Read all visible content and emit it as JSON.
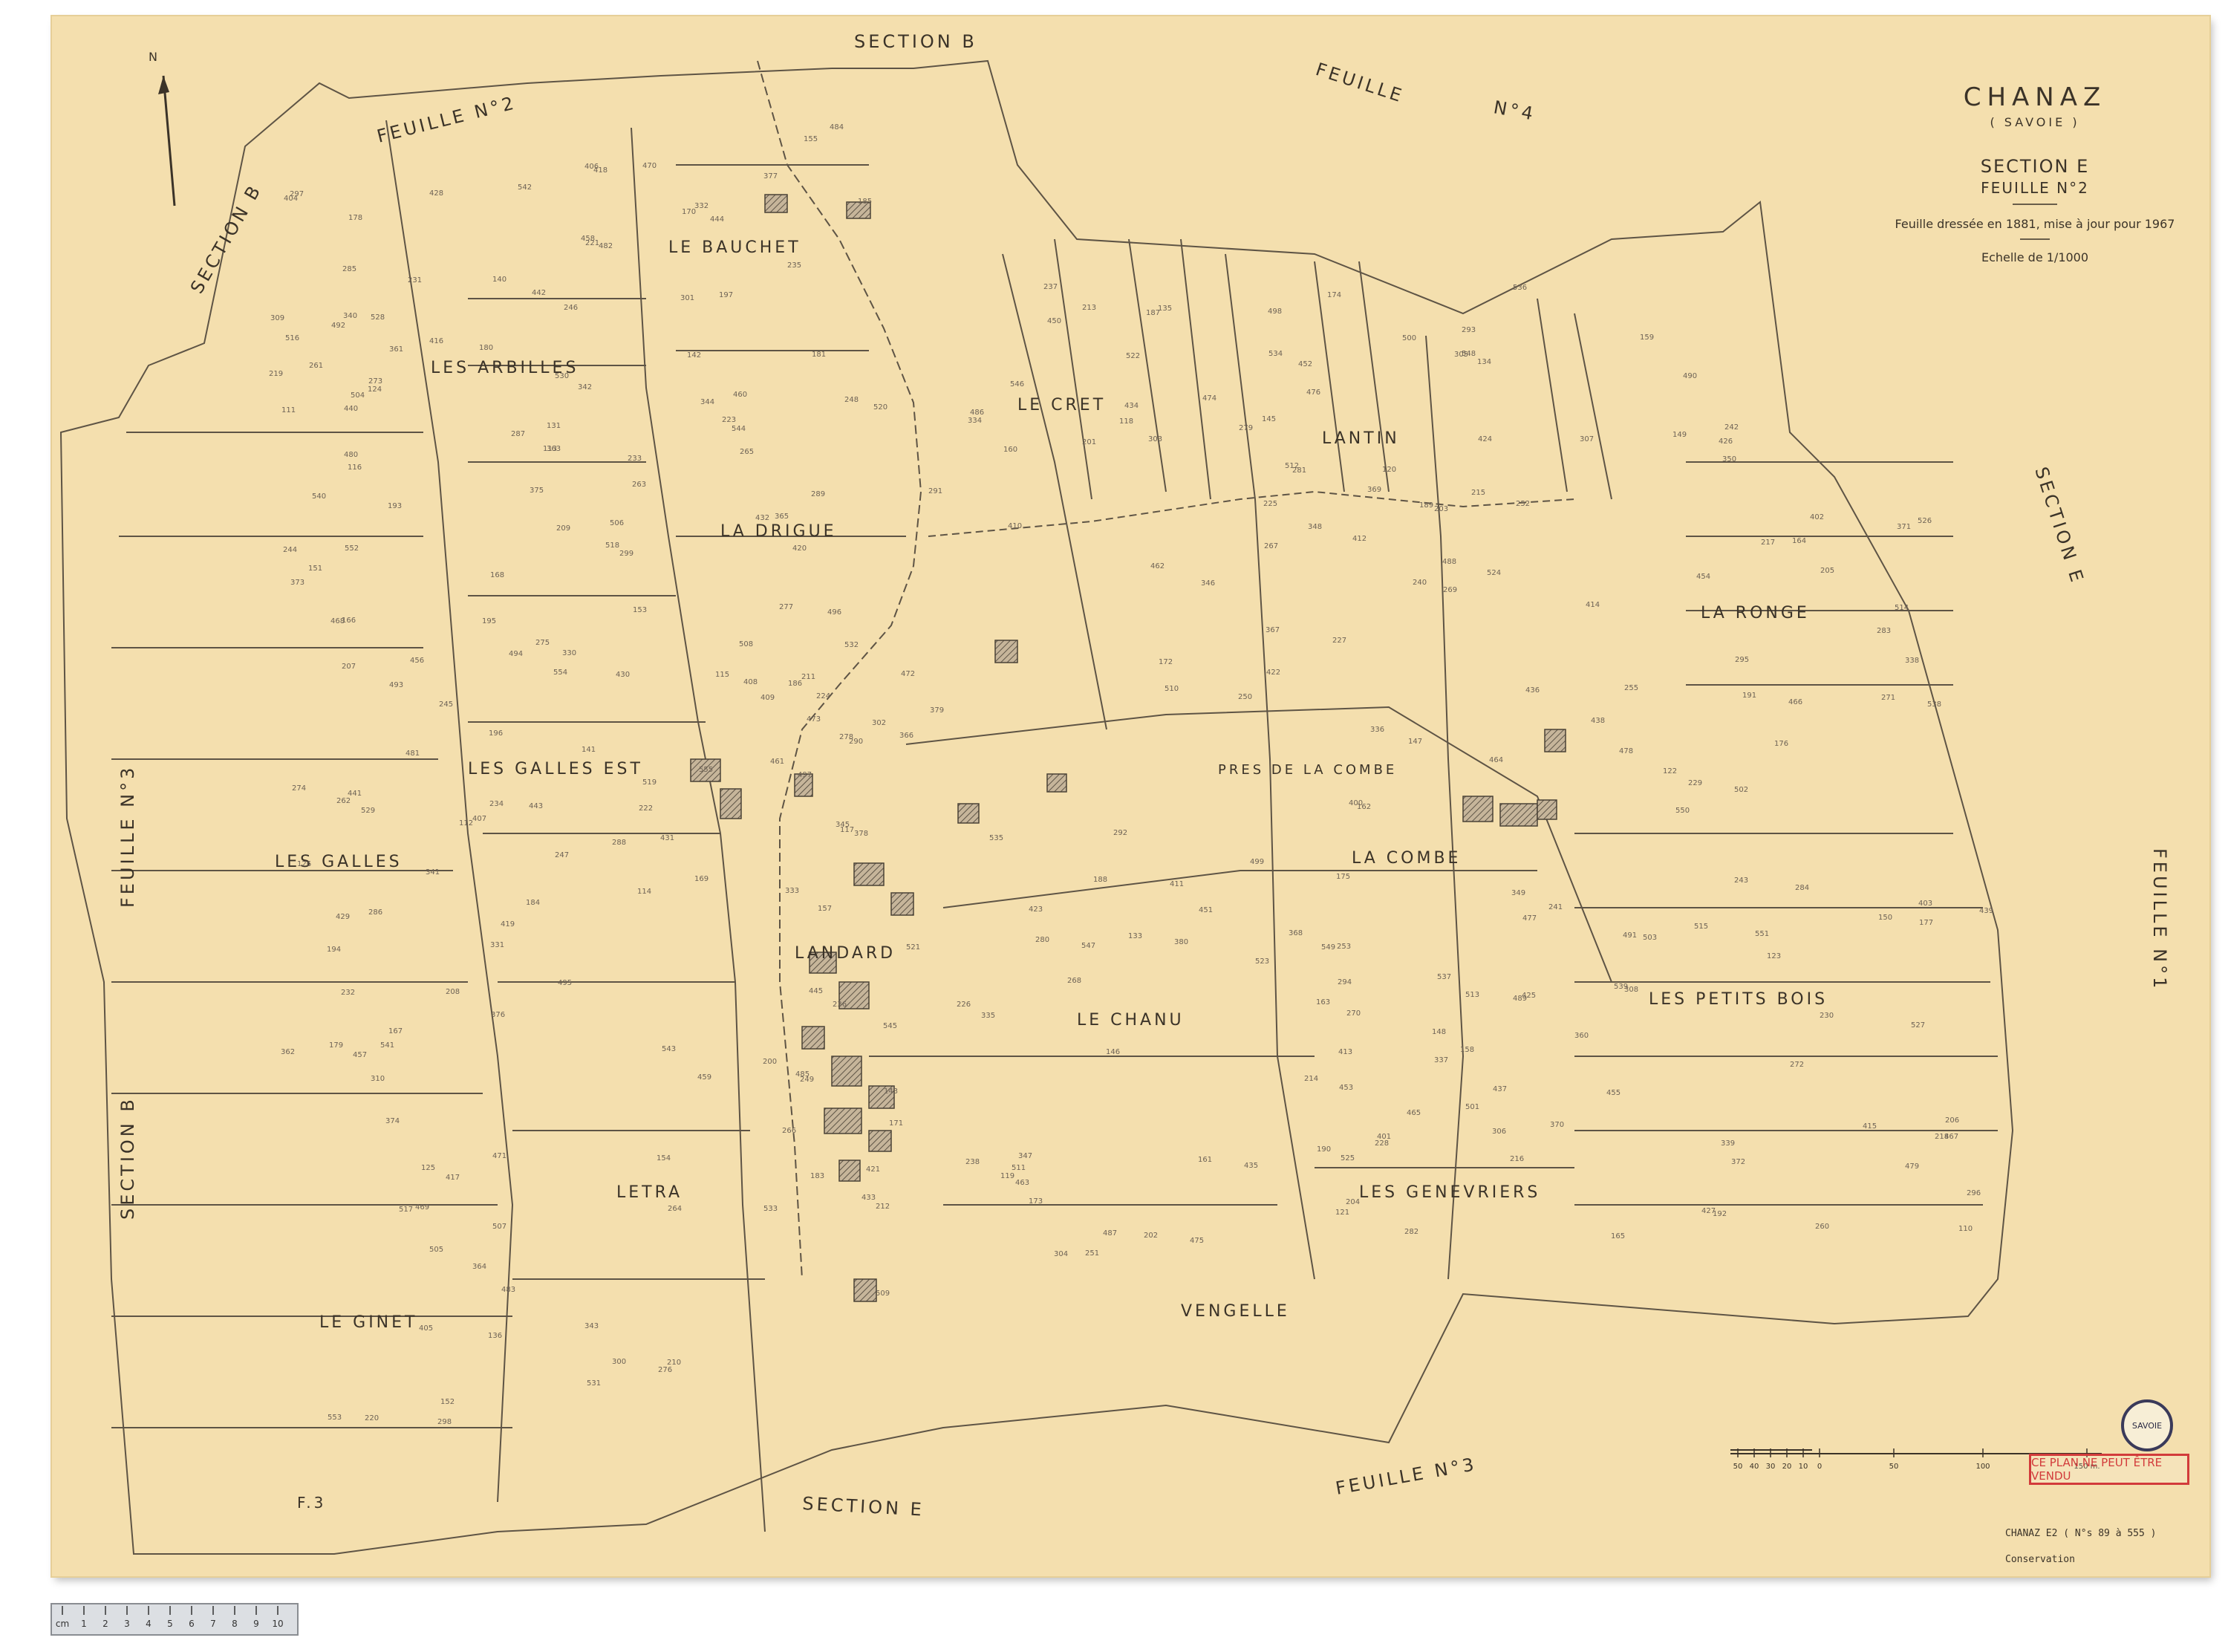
{
  "title": {
    "commune": "CHANAZ",
    "department": "( SAVOIE )",
    "section": "SECTION E",
    "sheet": "FEUILLE N°2",
    "note": "Feuille dressée en 1881, mise à jour pour 1967",
    "scale": "Echelle de 1/1000"
  },
  "north_label": "N",
  "border_labels": {
    "top_section": "SECTION   B",
    "top_left_feuille": "FEUILLE  N°2",
    "top_right_feuille": "FEUILLE",
    "top_right_no": "N°4",
    "left_section_top": "SECTION   B",
    "left_feuille": "FEUILLE  N°3",
    "left_section_bottom": "SECTION   B",
    "right_section": "SECTION   E",
    "right_feuille": "FEUILLE   N°1",
    "bottom_section": "SECTION   E",
    "bottom_feuille": "FEUILLE   N°3",
    "bottom_left_ref": "F.3"
  },
  "localities": [
    "LE BAUCHET",
    "LES ARBILLES",
    "LA DRIGUE",
    "LE CRET",
    "LANTIN",
    "LA RONGE",
    "LES GALLES EST",
    "LES GALLES",
    "LANDARD",
    "PRES DE LA COMBE",
    "LA COMBE",
    "LE CHANU",
    "LES PETITS BOIS",
    "LES GENEVRIERS",
    "LETRA",
    "LE GINET",
    "VENGELLE"
  ],
  "parcel_numbers": [
    "116",
    "126",
    "131",
    "136",
    "181",
    "183",
    "135",
    "133",
    "134",
    "158",
    "159",
    "110",
    "111",
    "112",
    "113",
    "114",
    "115",
    "117",
    "118",
    "119",
    "120",
    "121",
    "122",
    "123",
    "124",
    "125",
    "140",
    "141",
    "142",
    "143",
    "145",
    "146",
    "147",
    "148",
    "149",
    "150",
    "151",
    "152",
    "153",
    "154",
    "155",
    "157",
    "160",
    "161",
    "162",
    "163",
    "164",
    "165",
    "166",
    "167",
    "168",
    "169",
    "170",
    "171",
    "172",
    "173",
    "174",
    "175",
    "176",
    "177",
    "178",
    "179",
    "180",
    "184",
    "185",
    "186",
    "187",
    "188",
    "189",
    "190",
    "191",
    "192",
    "193",
    "194",
    "195",
    "196",
    "197",
    "200",
    "201",
    "202",
    "203",
    "204",
    "205",
    "206",
    "207",
    "208",
    "209",
    "210",
    "211",
    "212",
    "213",
    "214",
    "215",
    "216",
    "217",
    "218",
    "219",
    "220",
    "221",
    "222",
    "223",
    "224",
    "225",
    "226",
    "227",
    "228",
    "229",
    "230",
    "231",
    "232",
    "233",
    "234",
    "235",
    "236",
    "237",
    "238",
    "240",
    "241",
    "242",
    "243",
    "244",
    "245",
    "246",
    "247",
    "248",
    "249",
    "250",
    "251",
    "252",
    "253",
    "255",
    "260",
    "261",
    "262",
    "263",
    "264",
    "265",
    "266",
    "267",
    "268",
    "269",
    "270",
    "271",
    "272",
    "273",
    "274",
    "275",
    "276",
    "277",
    "278",
    "279",
    "280",
    "281",
    "282",
    "283",
    "284",
    "285",
    "286",
    "287",
    "288",
    "289",
    "290",
    "291",
    "292",
    "293",
    "294",
    "295",
    "296",
    "297",
    "298",
    "299",
    "300",
    "301",
    "302",
    "303",
    "304",
    "305",
    "306",
    "307",
    "308",
    "309",
    "310",
    "330",
    "331",
    "332",
    "333",
    "334",
    "335",
    "336",
    "337",
    "338",
    "339",
    "340",
    "341",
    "342",
    "343",
    "344",
    "345",
    "346",
    "347",
    "348",
    "349",
    "350",
    "360",
    "361",
    "362",
    "363",
    "364",
    "365",
    "366",
    "367",
    "368",
    "369",
    "370",
    "371",
    "372",
    "373",
    "374",
    "375",
    "376",
    "377",
    "378",
    "379",
    "380",
    "400",
    "401",
    "402",
    "403",
    "404",
    "405",
    "406",
    "407",
    "408",
    "409",
    "410",
    "411",
    "412",
    "413",
    "414",
    "415",
    "416",
    "417",
    "418",
    "419",
    "420",
    "421",
    "422",
    "423",
    "424",
    "425",
    "426",
    "427",
    "428",
    "429",
    "430",
    "431",
    "432",
    "433",
    "434",
    "435",
    "436",
    "437",
    "438",
    "439",
    "440",
    "441",
    "442",
    "443",
    "444",
    "445",
    "450",
    "451",
    "452",
    "453",
    "454",
    "455",
    "456",
    "457",
    "458",
    "459",
    "460",
    "461",
    "462",
    "463",
    "464",
    "465",
    "466",
    "467",
    "468",
    "469",
    "470",
    "471",
    "472",
    "473",
    "474",
    "475",
    "476",
    "477",
    "478",
    "479",
    "480",
    "481",
    "482",
    "483",
    "484",
    "485",
    "486",
    "487",
    "488",
    "489",
    "490",
    "491",
    "492",
    "493",
    "494",
    "495",
    "496",
    "497",
    "498",
    "499",
    "500",
    "501",
    "502",
    "503",
    "504",
    "505",
    "506",
    "507",
    "508",
    "509",
    "510",
    "511",
    "512",
    "513",
    "514",
    "515",
    "516",
    "517",
    "518",
    "519",
    "520",
    "521",
    "522",
    "523",
    "524",
    "525",
    "526",
    "527",
    "528",
    "529",
    "530",
    "531",
    "532",
    "533",
    "534",
    "535",
    "536",
    "537",
    "538",
    "539",
    "540",
    "541",
    "542",
    "543",
    "544",
    "545",
    "546",
    "547",
    "548",
    "549",
    "550",
    "551",
    "552",
    "553",
    "554",
    "555"
  ],
  "scale_bar_ticks": [
    "50",
    "40",
    "30",
    "20",
    "10",
    "0",
    "50",
    "100",
    "150 m."
  ],
  "stamp_text": "CE PLAN NE PEUT ÊTRE VENDU",
  "seal_text": "SAVOIE",
  "footer_code": "CHANAZ E2 ( N°s 89 à 555 )",
  "conservation": "Conservation",
  "ruler_ticks": [
    "cm",
    "1",
    "2",
    "3",
    "4",
    "5",
    "6",
    "7",
    "8",
    "9",
    "10"
  ],
  "colors": {
    "paper": "#f4dfae",
    "ink": "#3b3328",
    "stamp_red": "#d23b3b",
    "building_hatch": "#8b7f70"
  }
}
